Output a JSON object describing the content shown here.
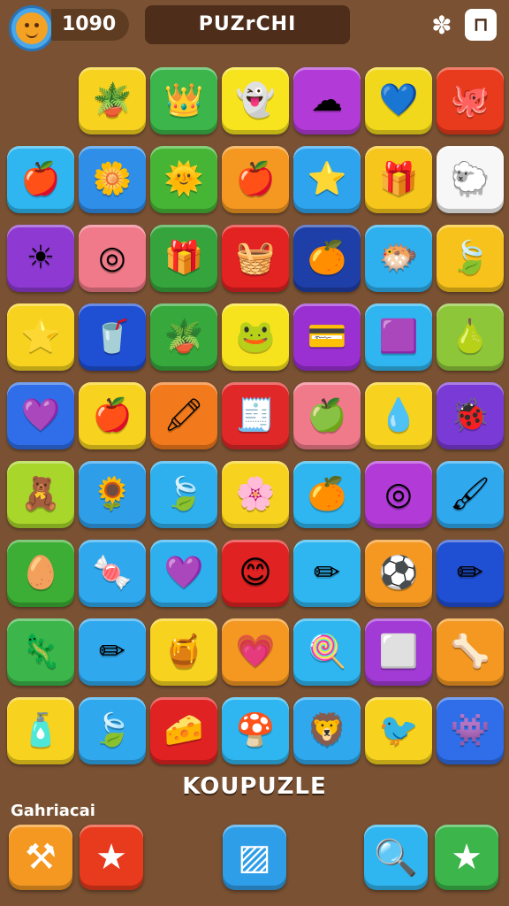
{
  "header": {
    "coins": "1090",
    "title": "PUZrCHI",
    "puzzle_icon": "puzzle-piece-icon",
    "exit_icon": "exit-door-icon"
  },
  "board": {
    "rows": 9,
    "cols": 7,
    "tiles": [
      {
        "color": "#f7d21e",
        "icon": "potted-plant",
        "glyph": "🪴"
      },
      {
        "color": "#3cb54a",
        "icon": "crown",
        "glyph": "👑"
      },
      {
        "color": "#f7e31e",
        "icon": "blue-ghost",
        "glyph": "👻"
      },
      {
        "color": "#b23ad6",
        "icon": "blue-blob",
        "glyph": "☁"
      },
      {
        "color": "#f2d81c",
        "icon": "blue-heart",
        "glyph": "💙"
      },
      {
        "color": "#e83a1c",
        "icon": "orange-monster",
        "glyph": "🐙"
      },
      {
        "color": "#2fb5ef",
        "icon": "red-apple",
        "glyph": "🍎"
      },
      {
        "color": "#2f8ee8",
        "icon": "yellow-flower",
        "glyph": "🌼"
      },
      {
        "color": "#46b535",
        "icon": "sun",
        "glyph": "🌞"
      },
      {
        "color": "#f49822",
        "icon": "red-apple",
        "glyph": "🍎"
      },
      {
        "color": "#2fa4ee",
        "icon": "white-star",
        "glyph": "⭐"
      },
      {
        "color": "#f7c61c",
        "icon": "gift-box",
        "glyph": "🎁"
      },
      {
        "color": "#f7f7f7",
        "icon": "white-sheep",
        "glyph": "🐑"
      },
      {
        "color": "#8e3ad2",
        "icon": "sun-star",
        "glyph": "☀"
      },
      {
        "color": "#f07a8a",
        "icon": "green-ring",
        "glyph": "◎"
      },
      {
        "color": "#36a43c",
        "icon": "red-box",
        "glyph": "🎁"
      },
      {
        "color": "#e32222",
        "icon": "blue-jar",
        "glyph": "🧺"
      },
      {
        "color": "#1f3fa8",
        "icon": "orange-fruit",
        "glyph": "🍊"
      },
      {
        "color": "#2fb0ee",
        "icon": "blue-fish",
        "glyph": "🐡"
      },
      {
        "color": "#f7c21c",
        "icon": "green-leaf",
        "glyph": "🍃"
      },
      {
        "color": "#f7d21e",
        "icon": "yellow-star",
        "glyph": "⭐"
      },
      {
        "color": "#1f4fd2",
        "icon": "ice-cream-cup",
        "glyph": "🥤"
      },
      {
        "color": "#36a83c",
        "icon": "potted-plant",
        "glyph": "🪴"
      },
      {
        "color": "#f7e21e",
        "icon": "green-face",
        "glyph": "🐸"
      },
      {
        "color": "#9a2fd2",
        "icon": "card",
        "glyph": "💳"
      },
      {
        "color": "#2fb5ef",
        "icon": "purple-square",
        "glyph": "🟪"
      },
      {
        "color": "#8ec63a",
        "icon": "orange-pear",
        "glyph": "🍐"
      },
      {
        "color": "#2f6ee8",
        "icon": "purple-heart",
        "glyph": "💜"
      },
      {
        "color": "#f7d21e",
        "icon": "red-apple",
        "glyph": "🍎"
      },
      {
        "color": "#f27a1c",
        "icon": "red-crayon",
        "glyph": "🖍"
      },
      {
        "color": "#e02828",
        "icon": "white-tray",
        "glyph": "🧾"
      },
      {
        "color": "#f07a8a",
        "icon": "green-apple",
        "glyph": "🍏"
      },
      {
        "color": "#f7d21e",
        "icon": "striped-drop",
        "glyph": "💧"
      },
      {
        "color": "#7a3ad6",
        "icon": "yellow-bug",
        "glyph": "🐞"
      },
      {
        "color": "#a8d62a",
        "icon": "bear",
        "glyph": "🧸"
      },
      {
        "color": "#2f9ee8",
        "icon": "lion-flower",
        "glyph": "🌻"
      },
      {
        "color": "#2fb0ee",
        "icon": "green-leaf",
        "glyph": "🍃"
      },
      {
        "color": "#f7d21e",
        "icon": "rainbow-flower",
        "glyph": "🌸"
      },
      {
        "color": "#2fb5ef",
        "icon": "orange-ball",
        "glyph": "🍊"
      },
      {
        "color": "#b23ad6",
        "icon": "green-ring",
        "glyph": "◎"
      },
      {
        "color": "#2fa8ee",
        "icon": "white-brush",
        "glyph": "🖌"
      },
      {
        "color": "#3cad35",
        "icon": "striped-egg",
        "glyph": "🥚"
      },
      {
        "color": "#2fa8ee",
        "icon": "purple-candy",
        "glyph": "🍬"
      },
      {
        "color": "#2fb0ee",
        "icon": "purple-heart",
        "glyph": "💜"
      },
      {
        "color": "#e02222",
        "icon": "yellow-face",
        "glyph": "😊"
      },
      {
        "color": "#2fb5ef",
        "icon": "orange-pencil",
        "glyph": "✏"
      },
      {
        "color": "#f49822",
        "icon": "striped-ball",
        "glyph": "⚽"
      },
      {
        "color": "#1f4fd2",
        "icon": "yellow-pencil",
        "glyph": "✏"
      },
      {
        "color": "#3cb54a",
        "icon": "green-lizard",
        "glyph": "🦎"
      },
      {
        "color": "#2fa8ee",
        "icon": "blue-pencil",
        "glyph": "✏"
      },
      {
        "color": "#f7d21e",
        "icon": "purple-pot",
        "glyph": "🍯"
      },
      {
        "color": "#f49822",
        "icon": "pink-heart",
        "glyph": "💗"
      },
      {
        "color": "#2fb5ef",
        "icon": "red-popsicle",
        "glyph": "🍭"
      },
      {
        "color": "#a23ad6",
        "icon": "purple-frame",
        "glyph": "⬜"
      },
      {
        "color": "#f49822",
        "icon": "green-bone",
        "glyph": "🦴"
      },
      {
        "color": "#f7d21e",
        "icon": "orange-bottle",
        "glyph": "🧴"
      },
      {
        "color": "#2fa8ee",
        "icon": "rainbow-leaf",
        "glyph": "🍃"
      },
      {
        "color": "#e02222",
        "icon": "cheese-slice",
        "glyph": "🧀"
      },
      {
        "color": "#2fb5ef",
        "icon": "mushroom",
        "glyph": "🍄"
      },
      {
        "color": "#2fa8ee",
        "icon": "lion-face",
        "glyph": "🦁"
      },
      {
        "color": "#f7d21e",
        "icon": "red-bird",
        "glyph": "🐦"
      },
      {
        "color": "#2f6ee8",
        "icon": "purple-monster",
        "glyph": "👾"
      }
    ]
  },
  "footer": {
    "game_name": "KOUPUZLE",
    "section_label": "Gahriacai"
  },
  "bottom_buttons": [
    {
      "name": "hammer-button",
      "icon": "hammer-icon",
      "color": "#f49822",
      "glyph": "⚒"
    },
    {
      "name": "star-button",
      "icon": "star-icon",
      "color": "#e83a1c",
      "glyph": "★"
    },
    {
      "name": "shuffle-button",
      "icon": "shuffle-tile-icon",
      "color": "#2f9ee8",
      "glyph": "▨"
    },
    {
      "name": "search-button",
      "icon": "search-icon",
      "color": "#2fb5ef",
      "glyph": "🔍"
    },
    {
      "name": "favorite-button",
      "icon": "star-icon",
      "color": "#3cb54a",
      "glyph": "★"
    }
  ]
}
